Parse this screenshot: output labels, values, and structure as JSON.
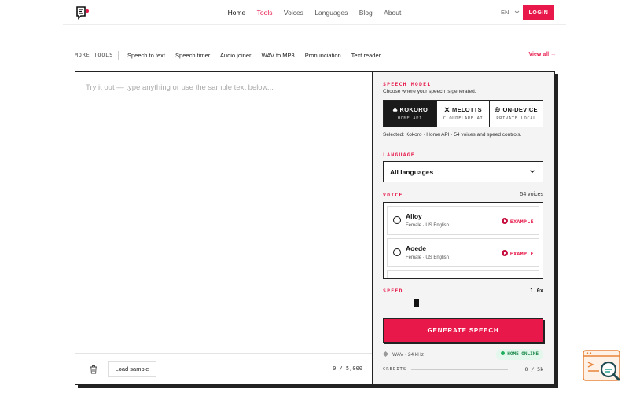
{
  "nav": {
    "items": [
      "Home",
      "Tools",
      "Voices",
      "Languages",
      "Blog",
      "About"
    ],
    "lang": "EN",
    "login": "LOGIN"
  },
  "tools": {
    "label": "MORE TOOLS",
    "links": [
      "Speech to text",
      "Speech timer",
      "Audio joiner",
      "WAV to MP3",
      "Pronunciation",
      "Text reader"
    ],
    "view_all": "View all →"
  },
  "editor": {
    "placeholder": "Try it out — type anything or use the sample text below...",
    "load_sample": "Load sample",
    "counter": "0 / 5,000"
  },
  "model": {
    "title": "SPEECH MODEL",
    "subtitle": "Choose where your speech is generated.",
    "options": [
      {
        "name": "KOKORO",
        "sub": "HOME API"
      },
      {
        "name": "MELOTTS",
        "sub": "CLOUDFLARE AI"
      },
      {
        "name": "ON-DEVICE",
        "sub": "PRIVATE LOCAL"
      }
    ],
    "selected_info": "Selected: Kokoro · Home API · 54 voices and speed controls."
  },
  "language": {
    "title": "LANGUAGE",
    "value": "All languages"
  },
  "voice": {
    "title": "VOICE",
    "count": "54 voices",
    "items": [
      {
        "name": "Alloy",
        "meta": "Female · US English",
        "example": "EXAMPLE"
      },
      {
        "name": "Aoede",
        "meta": "Female · US English",
        "example": "EXAMPLE"
      }
    ]
  },
  "speed": {
    "title": "SPEED",
    "value": "1.0x"
  },
  "generate": "GENERATE SPEECH",
  "status": {
    "format": "WAV · 24 kHz",
    "server": "HOME ONLINE",
    "credits_label": "CREDITS",
    "credits_value": "0 / 5k"
  },
  "colors": {
    "accent": "#e8194a",
    "online": "#1fae5b"
  }
}
